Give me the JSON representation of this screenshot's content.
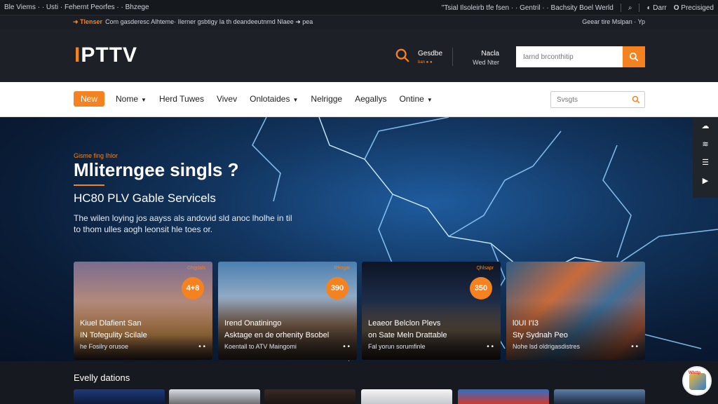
{
  "topbar": {
    "left_text": "Ble Viems · · Usti · Fehernt Peorfes · · Bhzege",
    "right_text": "\"Tsial Ilsoleirb tfe fsen · · Gentril · · Bachsity Boel Werld",
    "icon_label": "d",
    "user_label": "Darr",
    "register_label": "Precisiged"
  },
  "announce": {
    "brand": "Tlenser",
    "text": "Com gasderesc Alhteme· Ilerner gsbtigy Ia th deandeeutnmd Nlaee ➜ pea",
    "right_text": "Geear tire Mslpan · Yp"
  },
  "header": {
    "logo_first": "I",
    "logo_rest": "PTTV",
    "group1_title": "Gesdbe",
    "group1_sub": "ban ● ●",
    "group2_title": "Nacla",
    "group2_sub": "Wed Nter",
    "search_placeholder": "Iarnd brconthitip"
  },
  "nav": {
    "new_label": "New",
    "items": [
      {
        "label": "Nome",
        "caret": true
      },
      {
        "label": "Herd Tuwes",
        "caret": false
      },
      {
        "label": "Vivev",
        "caret": false
      },
      {
        "label": "Onlotaides",
        "caret": true
      },
      {
        "label": "Nelrigge",
        "caret": false
      },
      {
        "label": "Aegallys",
        "caret": false
      },
      {
        "label": "Ontine",
        "caret": true
      }
    ],
    "search_placeholder": "Svsgts"
  },
  "hero": {
    "eyebrow": "Gisme fing Ihlor",
    "title": "Mliterngee singls ?",
    "subtitle": "HC80 PLV Gable Servicels",
    "description": "The wilen loying jos aayss als andovid sld anoc lholhe in til to thom ulles aogh leonsit hle toes or."
  },
  "side_icons": [
    "cloud-icon",
    "wifi-icon",
    "list-icon",
    "play-icon"
  ],
  "cards": [
    {
      "badge_top": "Ghgdals",
      "badge": "4+8",
      "t1": "Kiuel Dlafient San",
      "t2": "IN Tofegulity Scilale",
      "t3": "he Fosilry orusoe",
      "more": "• •",
      "bg": "linear-gradient(180deg,#7b6c8e 0%,#b98c7a 45%,#e8a25a 75%,#3b2a28 100%)"
    },
    {
      "badge_top": "Rhogat",
      "badge": "390",
      "t1": "Irend Onatiningo",
      "t2": "Asktage en de orhenity Bsobel",
      "t3": "Koentall to ATV Maingomi",
      "more": "• •",
      "bg": "linear-gradient(180deg,#4a7fb0 0%,#8fa9c4 35%,#8a6b54 65%,#3a2c22 100%)"
    },
    {
      "badge_top": "Qhlsapr",
      "badge": "350",
      "t1": "Leaeor Belclon Plevs",
      "t2": "on Sate Meln Drattable",
      "t3": "Fal yorun sorumfinle",
      "more": "• •",
      "bg": "linear-gradient(180deg,#0d1525 0%,#1d2c48 40%,#6a5a4a 70%,#241c18 100%)"
    },
    {
      "badge_top": "",
      "badge": "",
      "t1": "l0UI I'I3",
      "t2": "Sty Sydnah Peo",
      "t3": "Nohe lsd oldrigasdistres",
      "more": "• •",
      "bg": "linear-gradient(135deg,#2f5d86 0%,#c86b3c 35%,#3f6f99 60%,#b05a3a 85%,#243f5e 100%)"
    }
  ],
  "bottom": {
    "title": "Evelly dations",
    "thumbs": [
      "linear-gradient(180deg,#1d3a7a,#0d1a3a)",
      "linear-gradient(180deg,#d8dce2,#6d6f73)",
      "linear-gradient(180deg,#3a2a24,#1a1412)",
      "linear-gradient(180deg,#f4f4f6,#c7c9cf)",
      "linear-gradient(180deg,#2b6fc9,#d3372c)",
      "linear-gradient(180deg,#5a7ea8,#1e2b3e)"
    ],
    "chat_label": "Whttp"
  },
  "colors": {
    "accent": "#f58220",
    "dark": "#1d2027",
    "hero": "#12355f"
  }
}
